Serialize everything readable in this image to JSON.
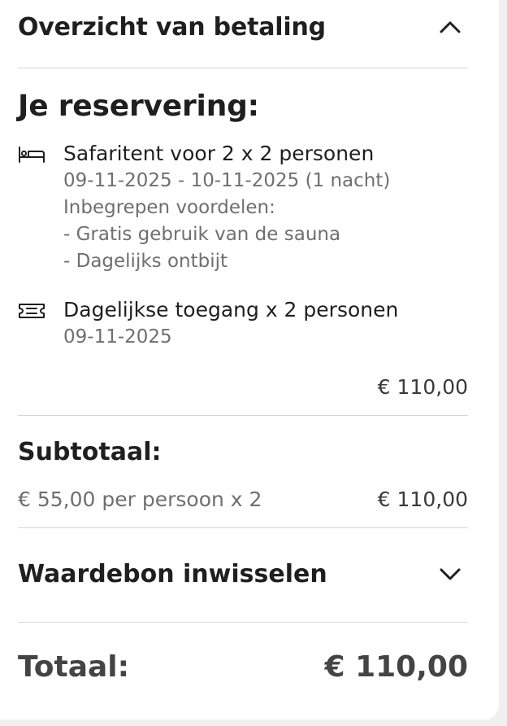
{
  "header": {
    "title": "Overzicht van betaling",
    "toggle_icon": "chevron-up-icon"
  },
  "reservation": {
    "heading": "Je reservering:",
    "items": [
      {
        "icon": "bed-icon",
        "title": "Safaritent voor 2 x 2 personen",
        "details": [
          "09-11-2025 - 10-11-2025 (1 nacht)",
          "Inbegrepen voordelen:",
          "- Gratis gebruik van de sauna",
          "- Dagelijks ontbijt"
        ]
      },
      {
        "icon": "ticket-icon",
        "title": "Dagelijkse toegang x 2 personen",
        "details": [
          "09-11-2025"
        ]
      }
    ],
    "amount": "€ 110,00"
  },
  "subtotal": {
    "heading": "Subtotaal:",
    "description": "€ 55,00 per persoon x 2",
    "amount": "€ 110,00"
  },
  "voucher": {
    "label": "Waardebon inwisselen",
    "toggle_icon": "chevron-down-icon"
  },
  "total": {
    "label": "Totaal:",
    "amount": "€ 110,00"
  }
}
